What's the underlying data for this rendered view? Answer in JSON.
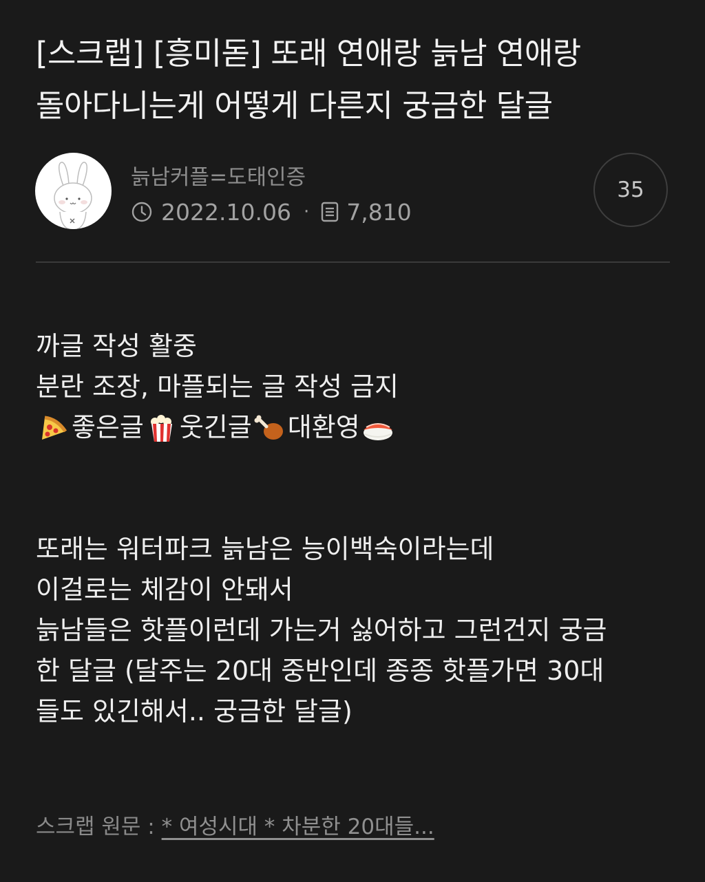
{
  "post": {
    "title_line1": "[스크랩] [흥미돋] 또래 연애랑 늙남 연애랑",
    "title_line2": "돌아다니는게 어떻게 다른지 궁금한 달글"
  },
  "author": {
    "name": "늙남커플=도태인증",
    "avatar_icon": "bunny-avatar-icon"
  },
  "meta": {
    "date_icon": "clock-icon",
    "date": "2022.10.06",
    "separator": "·",
    "views_icon": "document-icon",
    "views": "7,810"
  },
  "comments": {
    "count": "35"
  },
  "content": {
    "notice_line1": "까글 작성 활중",
    "notice_line2": "분란 조장, 마플되는 글 작성 금지",
    "notice_line3": {
      "item1_icon": "pizza-icon",
      "item1": "좋은글",
      "item2_icon": "popcorn-icon",
      "item2": "웃긴글",
      "item3_icon": "chicken-leg-icon",
      "item3": "대환영",
      "end_icon": "sushi-icon"
    },
    "paragraph": [
      "또래는 워터파크 늙남은 능이백숙이라는데",
      "이걸로는 체감이 안돼서",
      "늙남들은 핫플이런데 가는거 싫어하고 그런건지 궁금",
      "한 달글 (달주는 20대 중반인데 종종 핫플가면 30대",
      "들도 있긴해서.. 궁금한 달글)"
    ]
  },
  "scrap": {
    "label": "스크랩 원문 :",
    "link_text": "* 여성시대 *  차분한 20대들..."
  },
  "colors": {
    "background": "#1a1a1a",
    "text": "#efefef",
    "muted": "#8d8d8d",
    "divider": "#3a3a3a"
  }
}
